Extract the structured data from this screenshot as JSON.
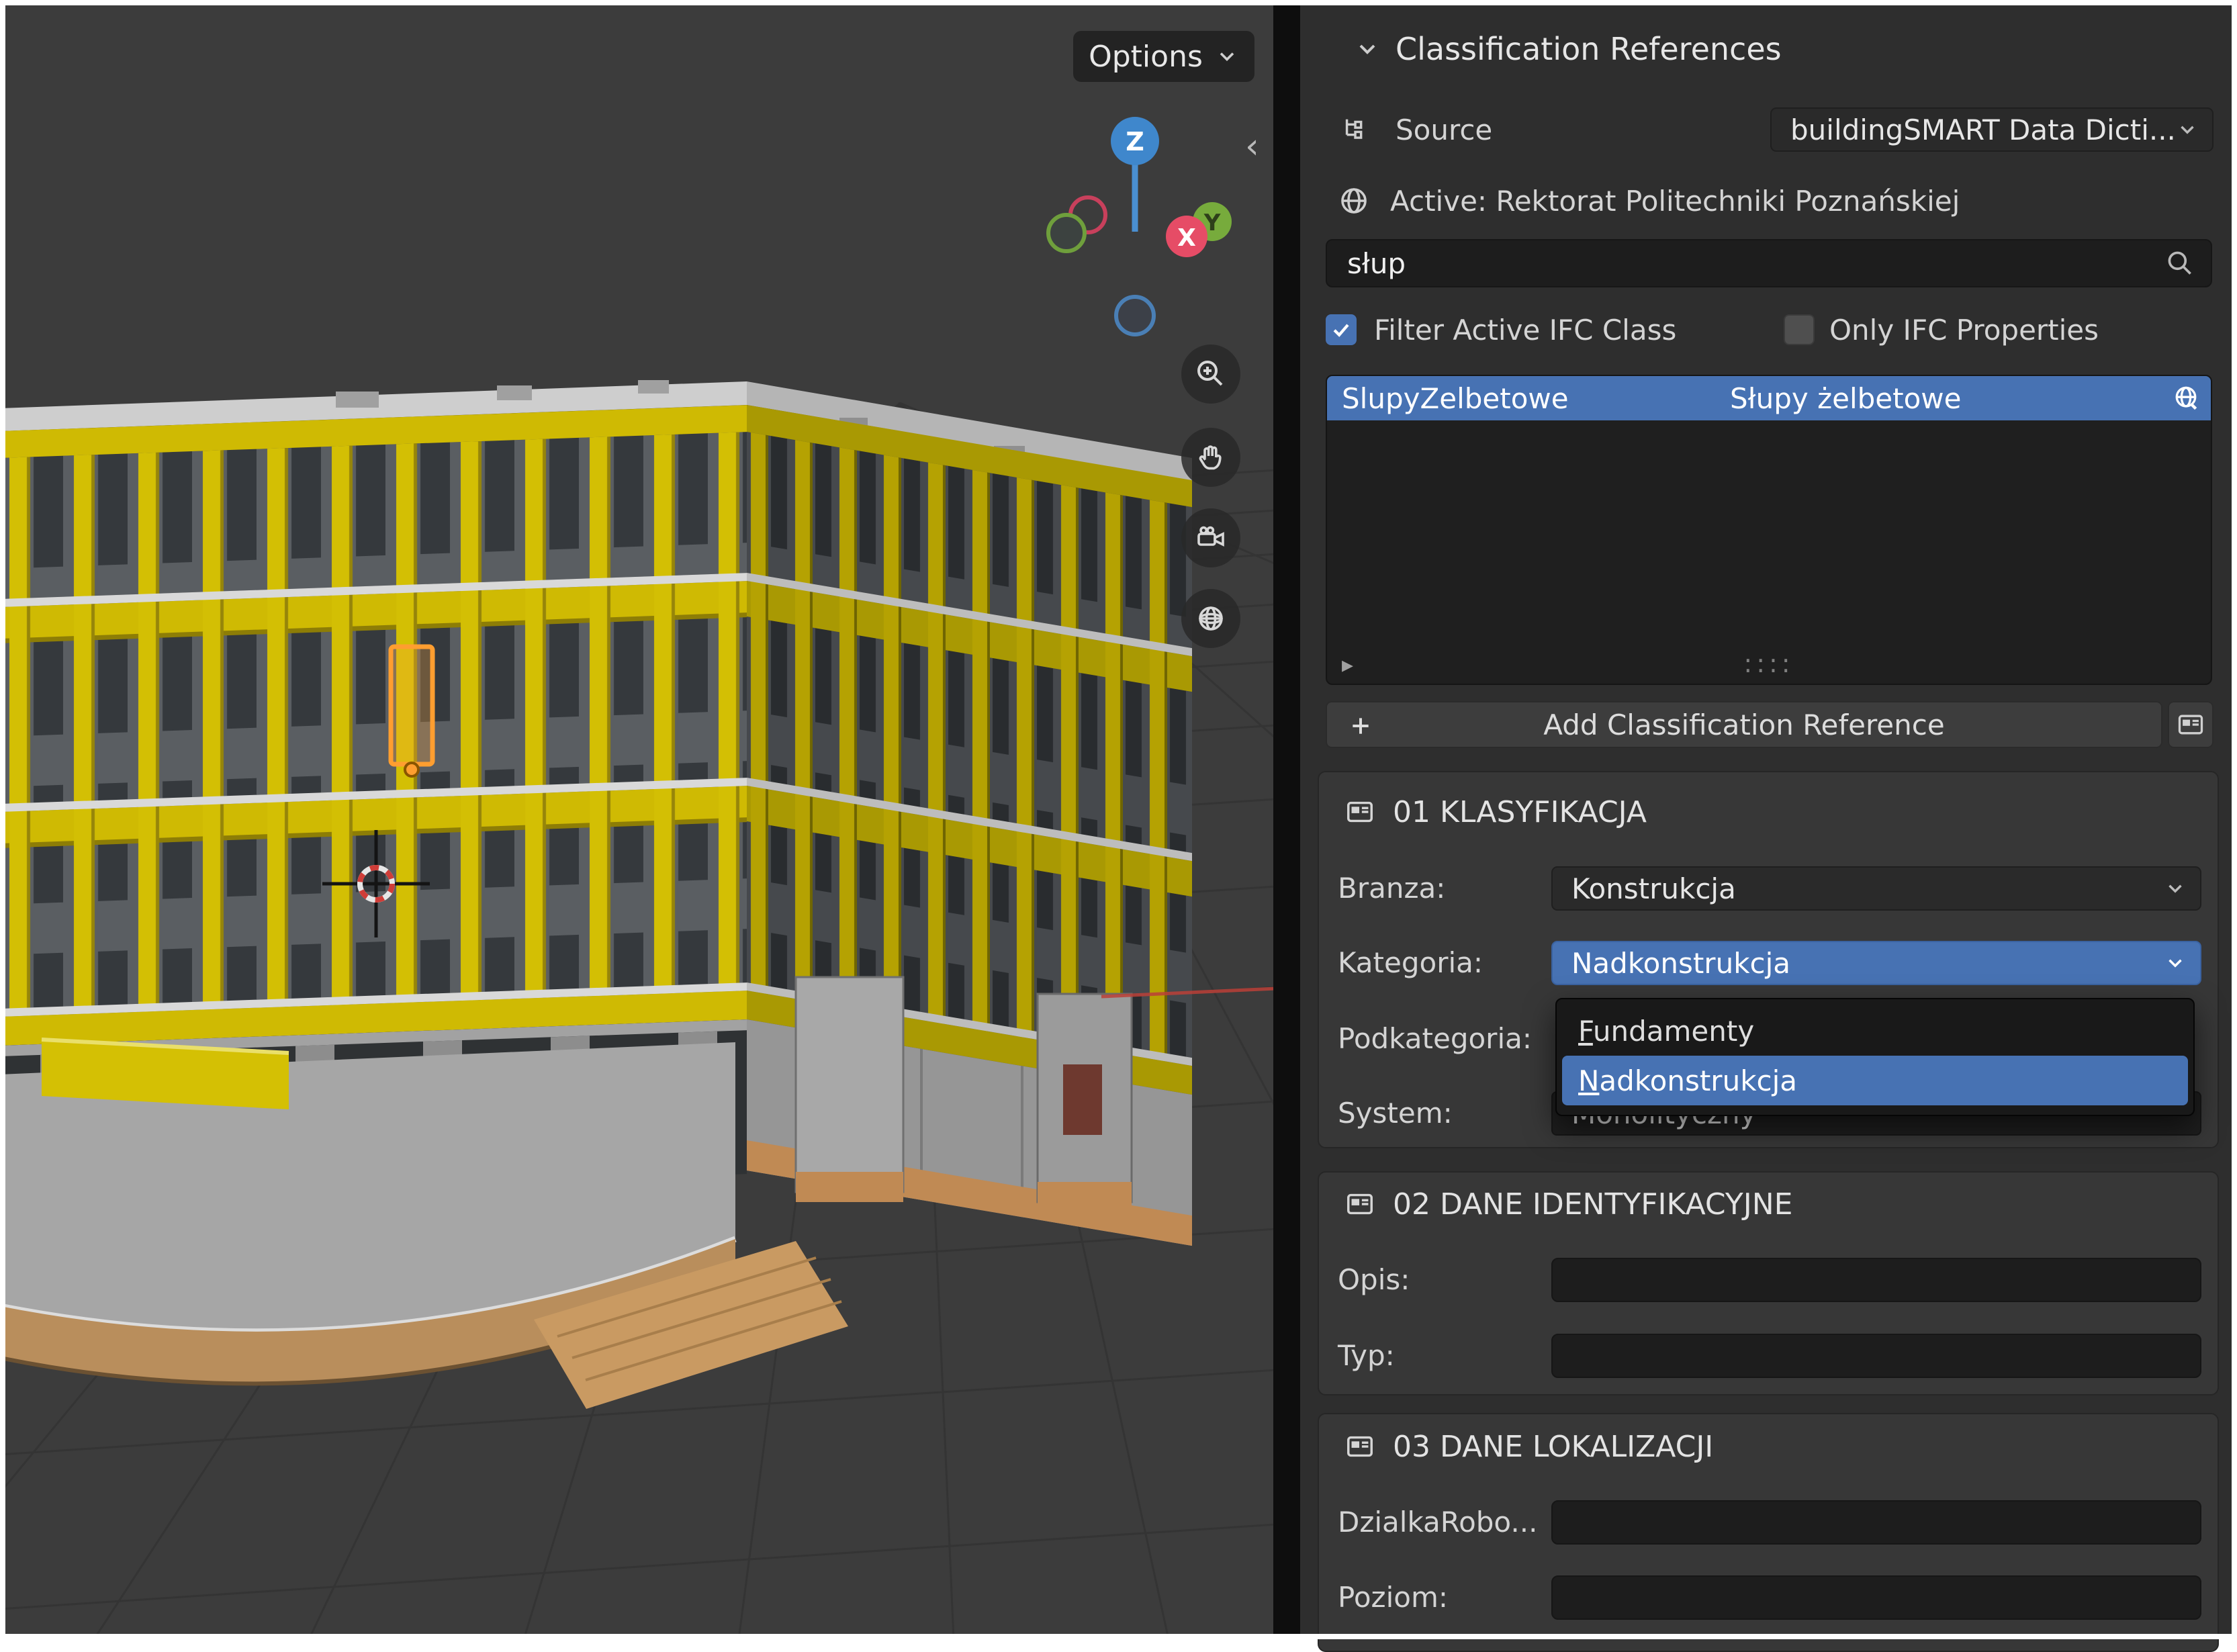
{
  "colors": {
    "accent_blue": "#4772b3",
    "selection_orange": "#ff9e30",
    "column_yellow": "#d3bf04",
    "viewport_bg": "#3c3c3c",
    "panel_bg": "#2e2e2e"
  },
  "viewport": {
    "options_button": "Options",
    "gizmo": {
      "z_label": "Z",
      "x_label": "X",
      "y_label": "Y"
    },
    "tools": {
      "zoom_icon": "magnifier-plus",
      "pan_icon": "hand",
      "camera_icon": "camera",
      "grid_icon": "grid-sphere"
    },
    "collapse_arrow": "‹"
  },
  "panel": {
    "title": "Classification References",
    "source": {
      "label": "Source",
      "value": "buildingSMART Data Dicti..."
    },
    "active_text": "Active: Rektorat Politechniki Poznańskiej",
    "search": {
      "value": "słup"
    },
    "filters": [
      {
        "label": "Filter Active IFC Class",
        "checked": true
      },
      {
        "label": "Only IFC Properties",
        "checked": false
      }
    ],
    "list": {
      "rows": [
        {
          "identification": "SlupyZelbetowe",
          "name": "Słupy żelbetowe"
        }
      ]
    },
    "add_button_label": "Add Classification Reference",
    "sections": [
      {
        "title": "01 KLASYFIKACJA",
        "fields": [
          {
            "label": "Branza:",
            "value": "Konstrukcja"
          },
          {
            "label": "Kategoria:",
            "value": "Nadkonstrukcja"
          },
          {
            "label": "Podkategoria:",
            "value": ""
          },
          {
            "label": "System:",
            "value": "Monolityczny"
          }
        ],
        "dropdown": {
          "options": [
            {
              "label": "Fundamenty",
              "selected": false
            },
            {
              "label": "Nadkonstrukcja",
              "selected": true
            }
          ]
        }
      },
      {
        "title": "02 DANE IDENTYFIKACYJNE",
        "fields": [
          {
            "label": "Opis:",
            "value": ""
          },
          {
            "label": "Typ:",
            "value": ""
          }
        ]
      },
      {
        "title": "03 DANE LOKALIZACJI",
        "fields": [
          {
            "label": "DzialkaRobo...",
            "value": ""
          },
          {
            "label": "Poziom:",
            "value": ""
          }
        ]
      }
    ]
  }
}
